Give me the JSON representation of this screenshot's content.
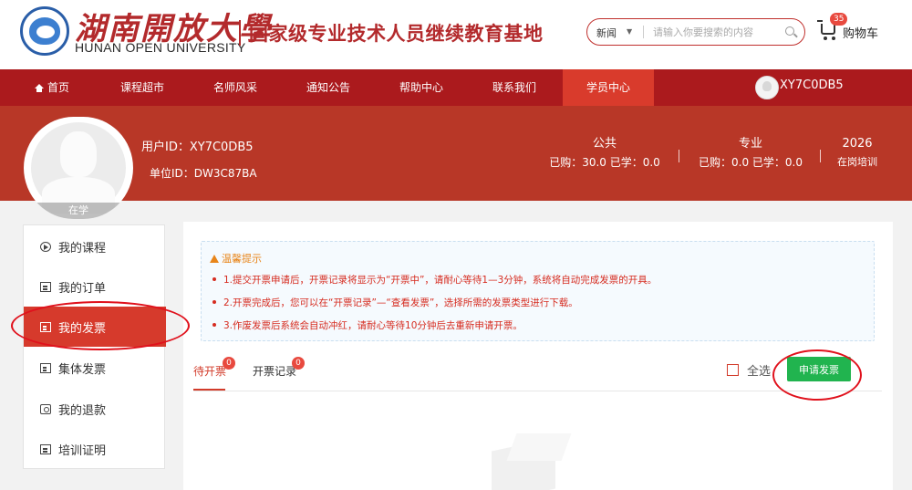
{
  "header": {
    "logo_cn": "湖南開放大學",
    "logo_en": "HUNAN OPEN UNIVERSITY",
    "slogan": "国家级专业技术人员继续教育基地",
    "search": {
      "category": "新闻",
      "placeholder": "请输入你要搜索的内容"
    },
    "cart": {
      "count": "35",
      "label": "购物车"
    }
  },
  "nav": {
    "items": [
      "首页",
      "课程超市",
      "名师风采",
      "通知公告",
      "帮助中心",
      "联系我们",
      "学员中心"
    ],
    "active": "学员中心",
    "username": "XY7C0DB5"
  },
  "profile": {
    "status": "在学",
    "user_id": "用户ID：XY7C0DB5",
    "unit_id": "单位ID：DW3C87BA",
    "stats": [
      {
        "title": "公共",
        "value": "已购：30.0 已学：0.0"
      },
      {
        "title": "专业",
        "value": "已购：0.0 已学：0.0"
      },
      {
        "title": "2026",
        "value": "在岗培训"
      }
    ]
  },
  "sidebar": {
    "items": [
      {
        "label": "我的课程",
        "icon": "play-circle-icon"
      },
      {
        "label": "我的订单",
        "icon": "order-icon"
      },
      {
        "label": "我的发票",
        "icon": "invoice-icon"
      },
      {
        "label": "集体发票",
        "icon": "group-invoice-icon"
      },
      {
        "label": "我的退款",
        "icon": "refund-icon"
      },
      {
        "label": "培训证明",
        "icon": "certificate-icon"
      }
    ],
    "active": "我的发票"
  },
  "tips": {
    "title": "温馨提示",
    "lines": [
      "1.提交开票申请后，开票记录将显示为“开票中”，请耐心等待1—3分钟，系统将自动完成发票的开具。",
      "2.开票完成后，您可以在“开票记录”—“查看发票”，选择所需的发票类型进行下载。",
      "3.作废发票后系统会自动冲红，请耐心等待10分钟后去重新申请开票。"
    ]
  },
  "tabs": [
    {
      "label": "待开票",
      "badge": "0"
    },
    {
      "label": "开票记录",
      "badge": "0"
    }
  ],
  "actions": {
    "select_all": "全选",
    "apply": "申请发票"
  },
  "colors": {
    "brand_red": "#ab1a1d",
    "banner_red": "#b83727",
    "active_red": "#d63a2c",
    "apply_green": "#21b44f",
    "annotation_red": "#e0111c"
  }
}
